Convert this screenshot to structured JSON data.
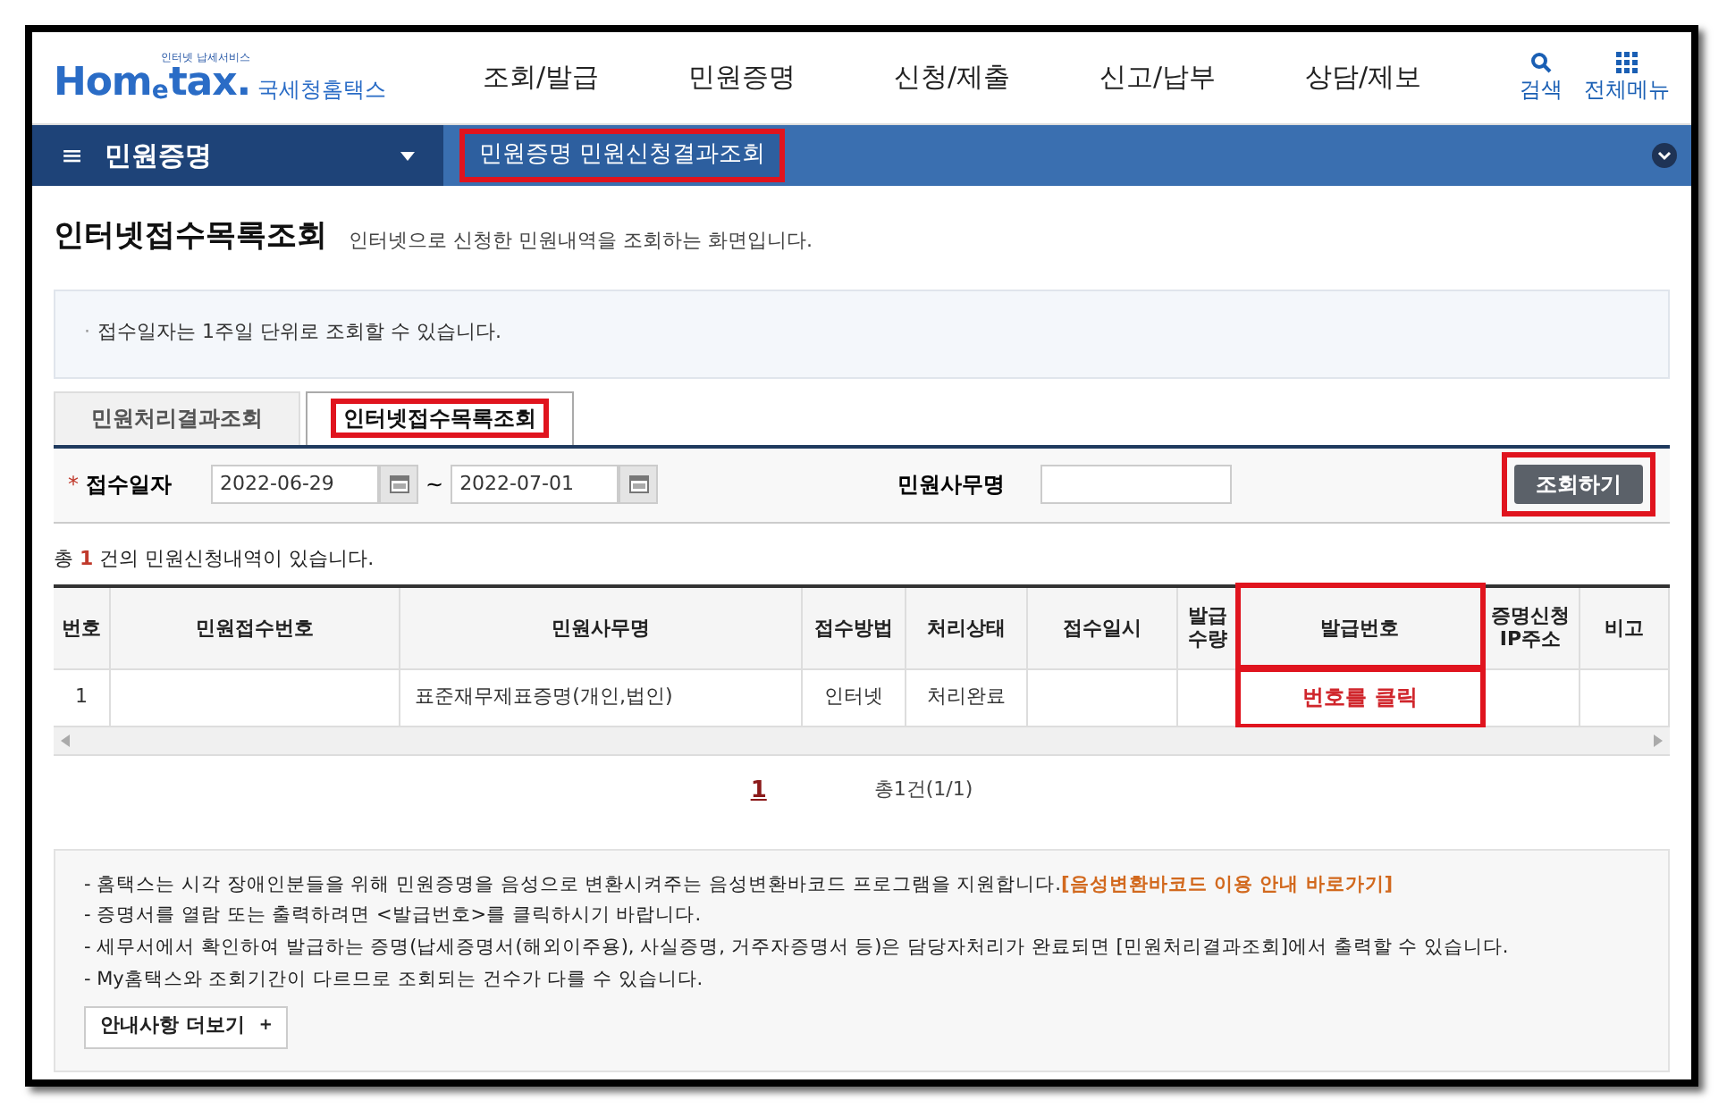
{
  "header": {
    "logo_small": "인터넷 납세서비스",
    "logo_main_a": "Hom",
    "logo_main_e": "e",
    "logo_main_b": "tax.",
    "logo_korean": "국세청홈택스",
    "nav": [
      "조회/발급",
      "민원증명",
      "신청/제출",
      "신고/납부",
      "상담/제보"
    ],
    "search": "검색",
    "all_menu": "전체메뉴"
  },
  "menu_bar": {
    "icon": "≡",
    "title": "민원증명",
    "breadcrumb": "민원증명 민원신청결과조회",
    "breadcrumb_highlighted": true
  },
  "page": {
    "title": "인터넷접수목록조회",
    "subtitle": "인터넷으로 신청한 민원내역을 조회하는 화면입니다."
  },
  "notice": {
    "bullet": "·",
    "text": "접수일자는 1주일 단위로 조회할 수 있습니다."
  },
  "tabs": [
    {
      "label": "민원처리결과조회",
      "selected": false,
      "highlighted": false
    },
    {
      "label": "인터넷접수목록조회",
      "selected": true,
      "highlighted": true
    }
  ],
  "search": {
    "required_mark": "*",
    "date_label": "접수일자",
    "date_from": "2022-06-29",
    "tilde": "~",
    "date_to": "2022-07-01",
    "name_label": "민원사무명",
    "button": "조회하기",
    "button_highlighted": true
  },
  "result_count": {
    "prefix": "총 ",
    "count": "1",
    "suffix": " 건의 민원신청내역이 있습니다."
  },
  "table": {
    "columns": [
      {
        "label": "번호",
        "highlighted": false
      },
      {
        "label": "민원접수번호",
        "highlighted": false
      },
      {
        "label": "민원사무명",
        "highlighted": false
      },
      {
        "label": "접수방법",
        "highlighted": false
      },
      {
        "label": "처리상태",
        "highlighted": false
      },
      {
        "label": "접수일시",
        "highlighted": false
      },
      {
        "label": "발급\n수량",
        "highlighted": false
      },
      {
        "label": "발급번호",
        "highlighted": true
      },
      {
        "label": "증명신청\nIP주소",
        "highlighted": false
      },
      {
        "label": "비고",
        "highlighted": false
      }
    ],
    "rows": [
      {
        "cells": [
          "1",
          "",
          "표준재무제표증명(개인,법인)",
          "인터넷",
          "처리완료",
          "",
          "",
          "번호를 클릭",
          "",
          ""
        ]
      }
    ]
  },
  "pagination": {
    "pages": [
      {
        "label": "1",
        "selected": true
      }
    ],
    "summary": "총1건(1/1)"
  },
  "info": {
    "lines": [
      {
        "text": "- 홈택스는 시각 장애인분들을 위해 민원증명을 음성으로 변환시켜주는 음성변환바코드 프로그램을 지원합니다.",
        "link": "[음성변환바코드 이용 안내 바로가기]"
      },
      {
        "text": "- 증명서를 열람 또는 출력하려면 <발급번호>를 클릭하시기 바랍니다."
      },
      {
        "text": "- 세무서에서 확인하여 발급하는 증명(납세증명서(해외이주용), 사실증명, 거주자증명서 등)은 담당자처리가 완료되면 [민원처리결과조회]에서 출력할 수 있습니다."
      },
      {
        "text": "- My홈택스와 조회기간이 다르므로 조회되는 건수가 다를 수 있습니다."
      }
    ],
    "more_button": "안내사항 더보기",
    "more_icon": "+"
  }
}
